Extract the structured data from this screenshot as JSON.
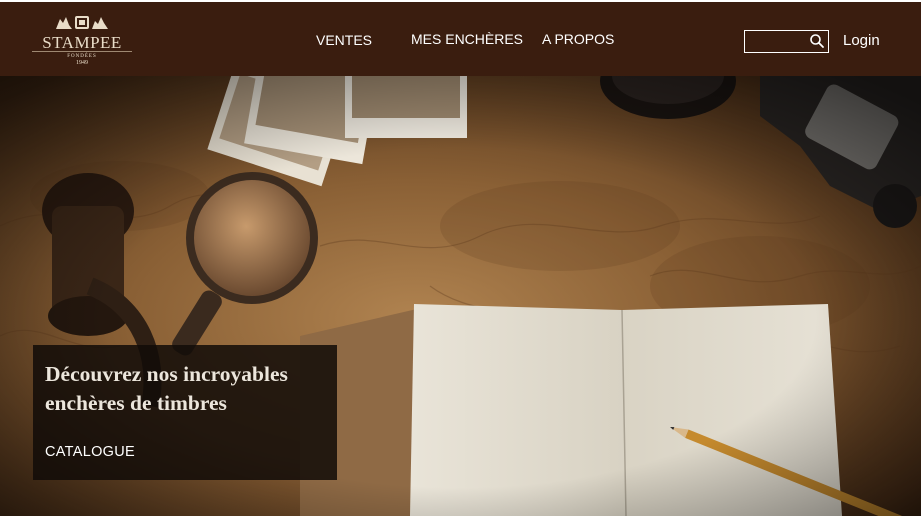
{
  "brand": {
    "name": "STAMPEE",
    "subtitle": "FONDÉES",
    "year": "1949"
  },
  "nav": {
    "items": [
      {
        "label": "VENTES"
      },
      {
        "label": "MES ENCHÈRES"
      },
      {
        "label": "A PROPOS"
      }
    ]
  },
  "search": {
    "value": "",
    "placeholder": ""
  },
  "auth": {
    "login_label": "Login"
  },
  "hero": {
    "headline_line1": "Découvrez nos incroyables",
    "headline_line2": "enchères de timbres",
    "cta_label": "CATALOGUE"
  },
  "colors": {
    "header_bg": "#3a1d0f",
    "promo_bg": "#120c08",
    "text_light": "#ffffff"
  }
}
